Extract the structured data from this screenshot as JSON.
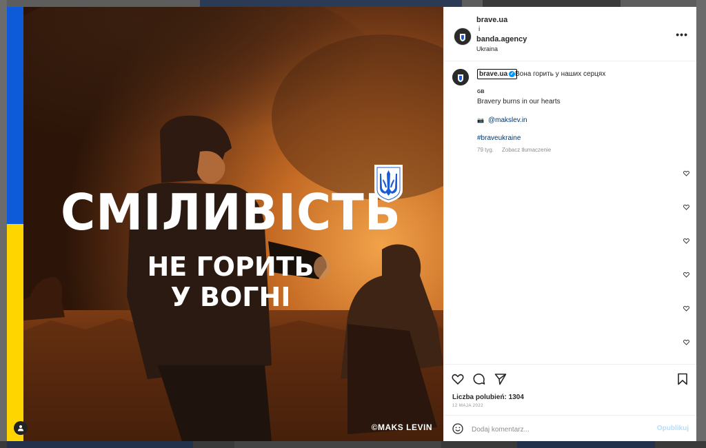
{
  "post": {
    "image": {
      "headline": "СМІЛИВІСТЬ",
      "subline_1": "НЕ ГОРИТЬ",
      "subline_2": "У ВОГНІ",
      "credit": "©MAKS LEVIN"
    },
    "header": {
      "author": "brave.ua",
      "separator": "i",
      "coauthor": "banda.agency",
      "location": "Ukraina",
      "more_label": "•••"
    },
    "caption": {
      "username": "brave.ua",
      "verified_mark": "✓",
      "text": "Вона горить у наших серцях",
      "lang_tag": "GB",
      "translation_line": "Bravery burns in our hearts",
      "mention": "@makslev.in",
      "hashtag": "#braveukraine",
      "age": "79 tyg.",
      "translate_label": "Zobacz tłumaczenie"
    },
    "likes": "Liczba polubień: 1304",
    "date": "12 MAJA 2022",
    "comment": {
      "placeholder": "Dodaj komentarz...",
      "publish_label": "Opublikuj"
    }
  },
  "colors": {
    "flag_blue": "#0d5bd8",
    "flag_yellow": "#ffd500",
    "link": "#00376b",
    "verified": "#0095f6",
    "publish_disabled": "#b2dffc"
  },
  "icons": [
    "heart-icon",
    "comment-icon",
    "share-icon",
    "bookmark-icon",
    "emoji-icon",
    "more-icon",
    "user-tag-icon",
    "trident-icon",
    "verified-icon"
  ]
}
